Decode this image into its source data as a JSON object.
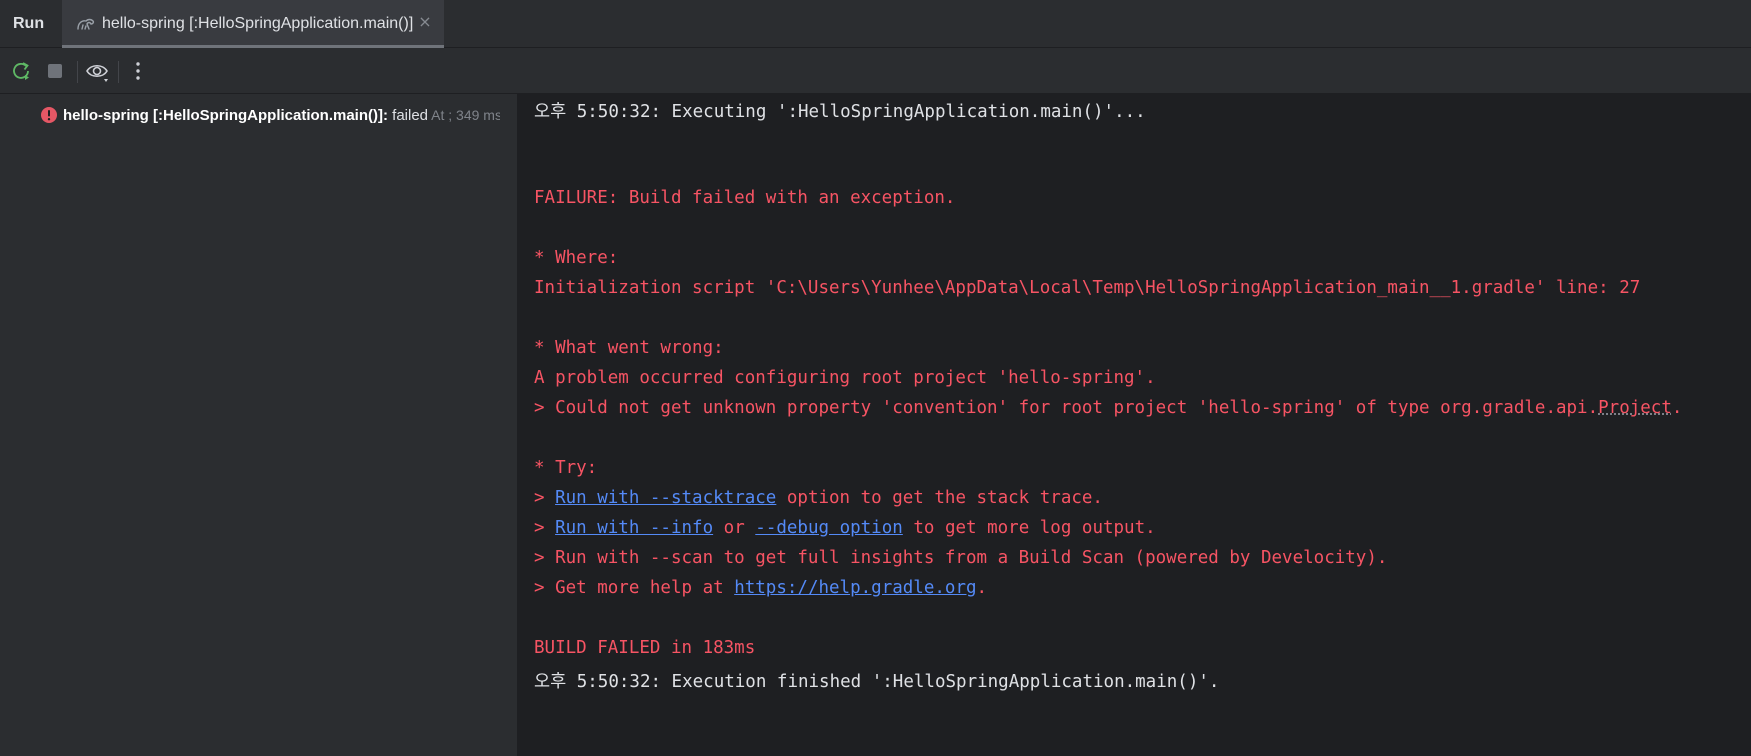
{
  "tabbar": {
    "run_label": "Run",
    "tab_label": "hello-spring [:HelloSpringApplication.main()]",
    "close_glyph": "×"
  },
  "toolbar": {
    "icons": [
      "rerun-icon",
      "stop-icon",
      "eye-icon",
      "more-vertical-icon"
    ]
  },
  "tree": {
    "item_name": "hello-spring [:HelloSpringApplication.main()]:",
    "item_status": " failed",
    "item_time": " At ; 349 ms"
  },
  "console": {
    "line1": "오후 5:50:32: Executing ':HelloSpringApplication.main()'...",
    "line2": "FAILURE: Build failed with an exception.",
    "line3": "* Where:",
    "line4": "Initialization script 'C:\\Users\\Yunhee\\AppData\\Local\\Temp\\HelloSpringApplication_main__1.gradle' line: 27",
    "line5": "* What went wrong:",
    "line6": "A problem occurred configuring root project 'hello-spring'.",
    "line7_pre": "> Could not get unknown property 'convention' for root project 'hello-spring' of type org.gradle.api.",
    "line7_word": "Project",
    "line7_post": ".",
    "line8": "* Try:",
    "line9_pre": "> ",
    "line9_link": "Run with --stacktrace",
    "line9_post": " option to get the stack trace.",
    "line10_pre": "> ",
    "line10_link1": "Run with --info",
    "line10_mid": " or ",
    "line10_link2": "--debug option",
    "line10_post": " to get more log output.",
    "line11": "> Run with --scan to get full insights from a Build Scan (powered by Develocity).",
    "line12_pre": "> Get more help at ",
    "line12_link": "https://help.gradle.org",
    "line12_post": ".",
    "line13": "BUILD FAILED in 183ms",
    "line14": "오후 5:50:32: Execution finished ':HelloSpringApplication.main()'."
  },
  "colors": {
    "error": "#f75464",
    "link": "#548af7",
    "text": "#dfe1e5",
    "background": "#1e1f22",
    "panel": "#2b2d30"
  }
}
